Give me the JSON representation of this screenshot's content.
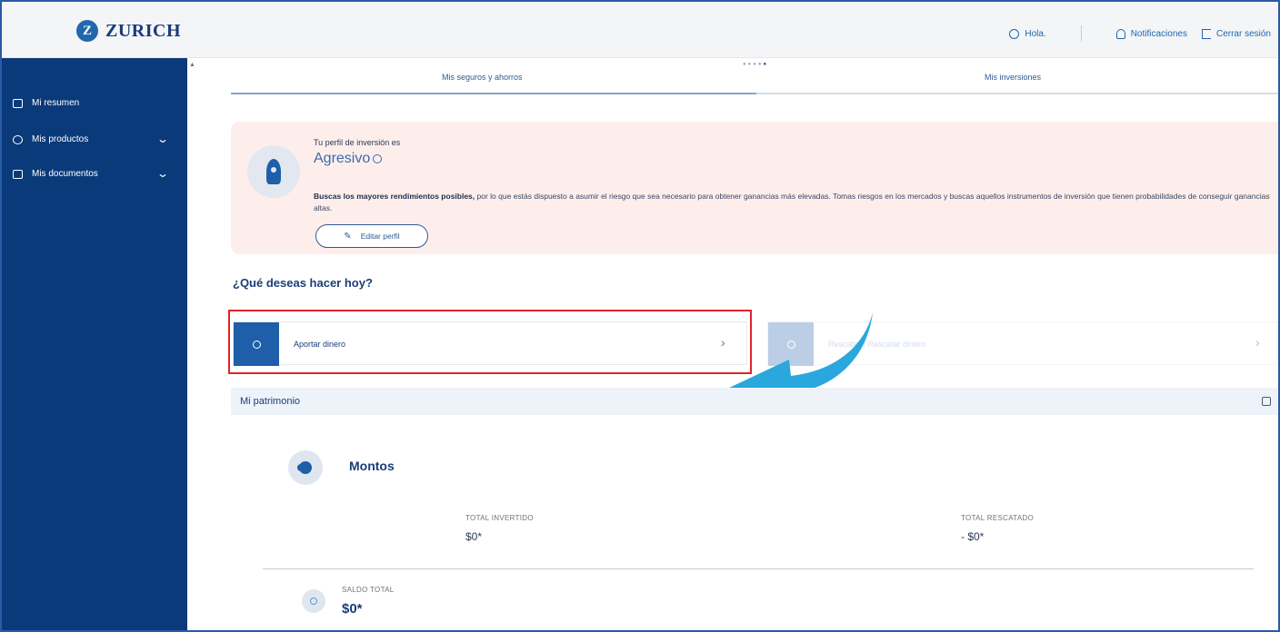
{
  "header": {
    "logo_text": "ZURICH",
    "logo_mark": "Z",
    "greeting": "Hola.",
    "notifications": "Notificaciones",
    "logout": "Cerrar sesión"
  },
  "sidebar": {
    "items": [
      {
        "label": "Mi resumen",
        "icon": "book-icon"
      },
      {
        "label": "Mis productos",
        "icon": "products-icon"
      },
      {
        "label": "Mis documentos",
        "icon": "folder-icon"
      }
    ]
  },
  "tabs": [
    {
      "label": "Mis seguros y ahorros"
    },
    {
      "label": "Mis inversiones"
    }
  ],
  "profile": {
    "label": "Tu perfil de inversión es",
    "type": "Agresivo",
    "desc_bold": "Buscas los mayores rendimientos posibles,",
    "desc_rest": " por lo que estás dispuesto a asumir el riesgo que sea necesario para obtener ganancias más elevadas. Tomas riesgos en los mercados y buscas aquellos instrumentos de inversión que tienen probabilidades de conseguir ganancias altas.",
    "edit_label": "Editar perfil"
  },
  "actions": {
    "heading": "¿Qué deseas hacer hoy?",
    "items": [
      {
        "label": "Aportar dinero"
      },
      {
        "label": "Rescatar / Rescatar dinero"
      }
    ]
  },
  "patrimonio": {
    "title": "Mi patrimonio",
    "montos_title": "Montos",
    "total_invertido_label": "TOTAL INVERTIDO",
    "total_invertido_value": "$0*",
    "total_rescatado_label": "TOTAL RESCATADO",
    "total_rescatado_value": "- $0*",
    "saldo_label": "SALDO TOTAL",
    "saldo_value": "$0*"
  },
  "colors": {
    "brand_blue": "#2167ae",
    "sidebar_bg": "#0a3a7a",
    "profile_bg": "#fdeeec",
    "highlight": "#e0232d",
    "arrow": "#2aa7dd"
  }
}
